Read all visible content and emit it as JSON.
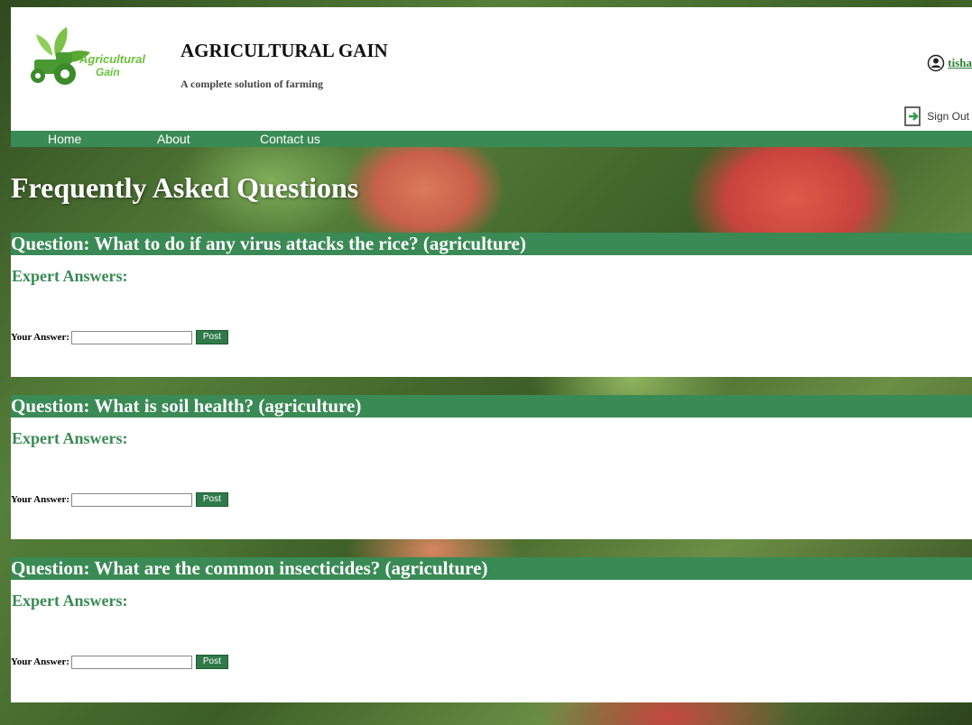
{
  "header": {
    "logo_text_line1": "Agricultural",
    "logo_text_line2": "Gain",
    "title": "AGRICULTURAL GAIN",
    "subtitle": "A complete solution of farming",
    "user_name": "tisha",
    "sign_out_label": "Sign Out"
  },
  "nav": {
    "items": [
      {
        "label": "Home"
      },
      {
        "label": "About"
      },
      {
        "label": "Contact us"
      }
    ]
  },
  "page_title": "Frequently Asked Questions",
  "questions": [
    {
      "text": "Question: What to do if any virus attacks the rice? (agriculture)",
      "expert_label": "Expert Answers:",
      "answer_label": "Your Answer:",
      "answer_value": "",
      "post_label": "Post"
    },
    {
      "text": "Question: What is soil health? (agriculture)",
      "expert_label": "Expert Answers:",
      "answer_label": "Your Answer:",
      "answer_value": "",
      "post_label": "Post"
    },
    {
      "text": "Question: What are the common insecticides? (agriculture)",
      "expert_label": "Expert Answers:",
      "answer_label": "Your Answer:",
      "answer_value": "",
      "post_label": "Post"
    }
  ],
  "colors": {
    "accent_green": "#3a8a55",
    "logo_green": "#6abf3a",
    "logo_dark": "#3a7d2a"
  }
}
